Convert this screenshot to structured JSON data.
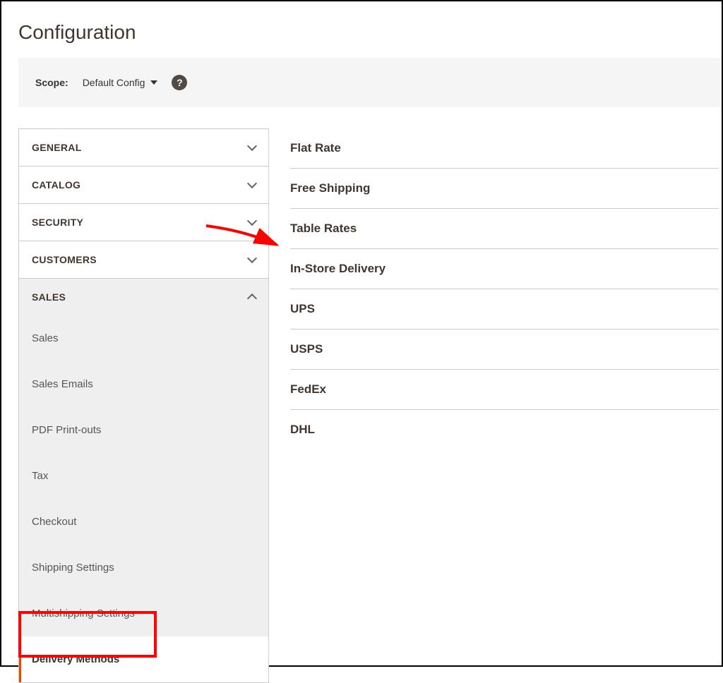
{
  "page": {
    "title": "Configuration"
  },
  "scope": {
    "label": "Scope:",
    "value": "Default Config"
  },
  "help": {
    "glyph": "?"
  },
  "sidebar": {
    "sections": {
      "general": {
        "label": "GENERAL"
      },
      "catalog": {
        "label": "CATALOG"
      },
      "security": {
        "label": "SECURITY"
      },
      "customers": {
        "label": "CUSTOMERS"
      },
      "sales": {
        "label": "SALES"
      }
    },
    "sales_items": [
      {
        "label": "Sales"
      },
      {
        "label": "Sales Emails"
      },
      {
        "label": "PDF Print-outs"
      },
      {
        "label": "Tax"
      },
      {
        "label": "Checkout"
      },
      {
        "label": "Shipping Settings"
      },
      {
        "label": "Multishipping Settings"
      },
      {
        "label": "Delivery Methods"
      }
    ]
  },
  "methods": [
    {
      "label": "Flat Rate"
    },
    {
      "label": "Free Shipping"
    },
    {
      "label": "Table Rates"
    },
    {
      "label": "In-Store Delivery"
    },
    {
      "label": "UPS"
    },
    {
      "label": "USPS"
    },
    {
      "label": "FedEx"
    },
    {
      "label": "DHL"
    }
  ]
}
